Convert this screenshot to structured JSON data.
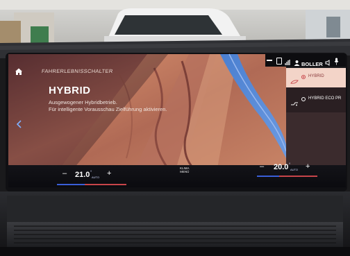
{
  "screen": {
    "breadcrumb": "FAHRERLEBNISSCHALTER",
    "mode_title": "HYBRID",
    "mode_desc_1": "Ausgewogener Hybridbetrieb.",
    "mode_desc_2": "Für intelligente Vorausschau Zielführung aktivieren.",
    "status_user": "BOLLER",
    "options": [
      {
        "label": "HYBRID",
        "selected": true
      },
      {
        "label": "HYBRID ECO PR",
        "selected": false
      }
    ]
  },
  "climate": {
    "left_temp": "21.0",
    "right_temp": "20.0",
    "auto_label": "AUTO",
    "unit": "°",
    "minus": "–",
    "plus": "+",
    "menu_line1": "KLIMA",
    "menu_line2": "MENÜ"
  },
  "colors": {
    "accent_red": "#c8454a",
    "accent_blue": "#3a5fd8",
    "desert": "#c9876a"
  },
  "icons": [
    "home-icon",
    "back-chevron-icon",
    "volume-icon",
    "microphone-icon",
    "bluetooth-icon",
    "sync-icon",
    "leaf-icon"
  ]
}
